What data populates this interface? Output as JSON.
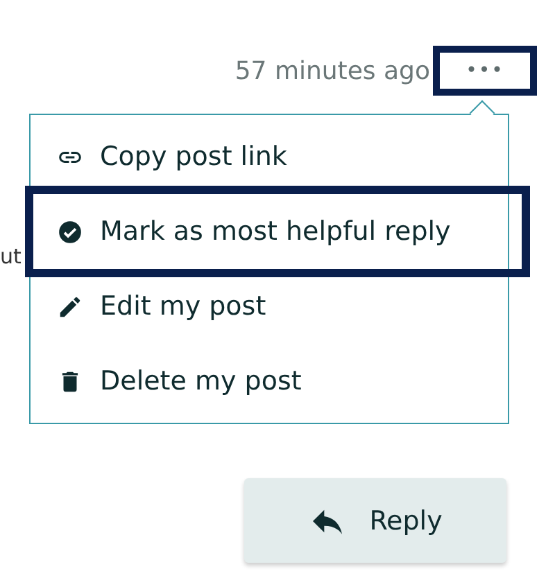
{
  "timestamp": "57 minutes ago",
  "more_button": {
    "label": "•••",
    "highlighted": true
  },
  "background_text": "ut",
  "menu": {
    "items": [
      {
        "kind": "link",
        "label": "Copy post link",
        "highlighted": false
      },
      {
        "kind": "check",
        "label": "Mark as most helpful reply",
        "highlighted": true
      },
      {
        "kind": "edit",
        "label": "Edit my post",
        "highlighted": false
      },
      {
        "kind": "delete",
        "label": "Delete my post",
        "highlighted": false
      }
    ]
  },
  "reply_button": {
    "label": "Reply"
  }
}
